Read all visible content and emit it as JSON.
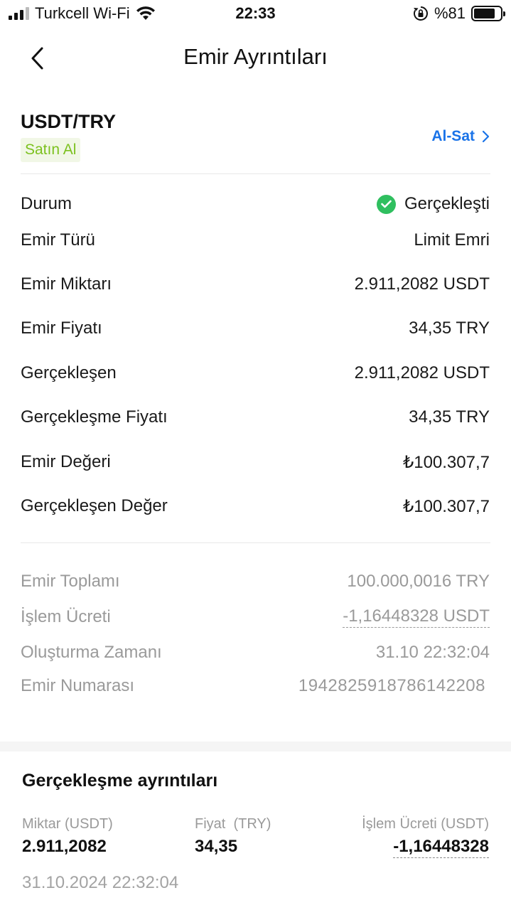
{
  "status_bar": {
    "carrier": "Turkcell Wi-Fi",
    "time": "22:33",
    "battery": "%81"
  },
  "nav": {
    "title": "Emir Ayrıntıları"
  },
  "order": {
    "pair": "USDT/TRY",
    "side": "Satın Al",
    "trade_link": "Al-Sat"
  },
  "details": {
    "status": {
      "label": "Durum",
      "value": "Gerçekleşti"
    },
    "order_type": {
      "label": "Emir Türü",
      "value": "Limit Emri"
    },
    "order_amount": {
      "label": "Emir Miktarı",
      "value": "2.911,2082 USDT"
    },
    "order_price": {
      "label": "Emir Fiyatı",
      "value": "34,35 TRY"
    },
    "filled": {
      "label": "Gerçekleşen",
      "value": "2.911,2082 USDT"
    },
    "fill_price": {
      "label": "Gerçekleşme Fiyatı",
      "value": "34,35 TRY"
    },
    "order_value": {
      "label": "Emir Değeri",
      "value": "₺100.307,7"
    },
    "filled_value": {
      "label": "Gerçekleşen Değer",
      "value": "₺100.307,7"
    }
  },
  "summary": {
    "order_total": {
      "label": "Emir Toplamı",
      "value": "100.000,0016 TRY"
    },
    "fee": {
      "label": "İşlem Ücreti",
      "value": "-1,16448328 USDT"
    },
    "created": {
      "label": "Oluşturma Zamanı",
      "value": "31.10 22:32:04"
    },
    "order_id": {
      "label": "Emir Numarası",
      "value": "1942825918786142208"
    }
  },
  "execution": {
    "title": "Gerçekleşme ayrıntıları",
    "amount_header": "Miktar (USDT)",
    "amount": "2.911,2082",
    "price_header": "Fiyat  (TRY)",
    "price": "34,35",
    "fee_header": "İşlem Ücreti (USDT)",
    "fee": "-1,16448328",
    "time": "31.10.2024 22:32:04"
  },
  "colors": {
    "accent_link": "#1a73e8",
    "buy_green": "#7cc11f",
    "success_green": "#2fbf5f",
    "muted_text": "#9a9a9a"
  }
}
